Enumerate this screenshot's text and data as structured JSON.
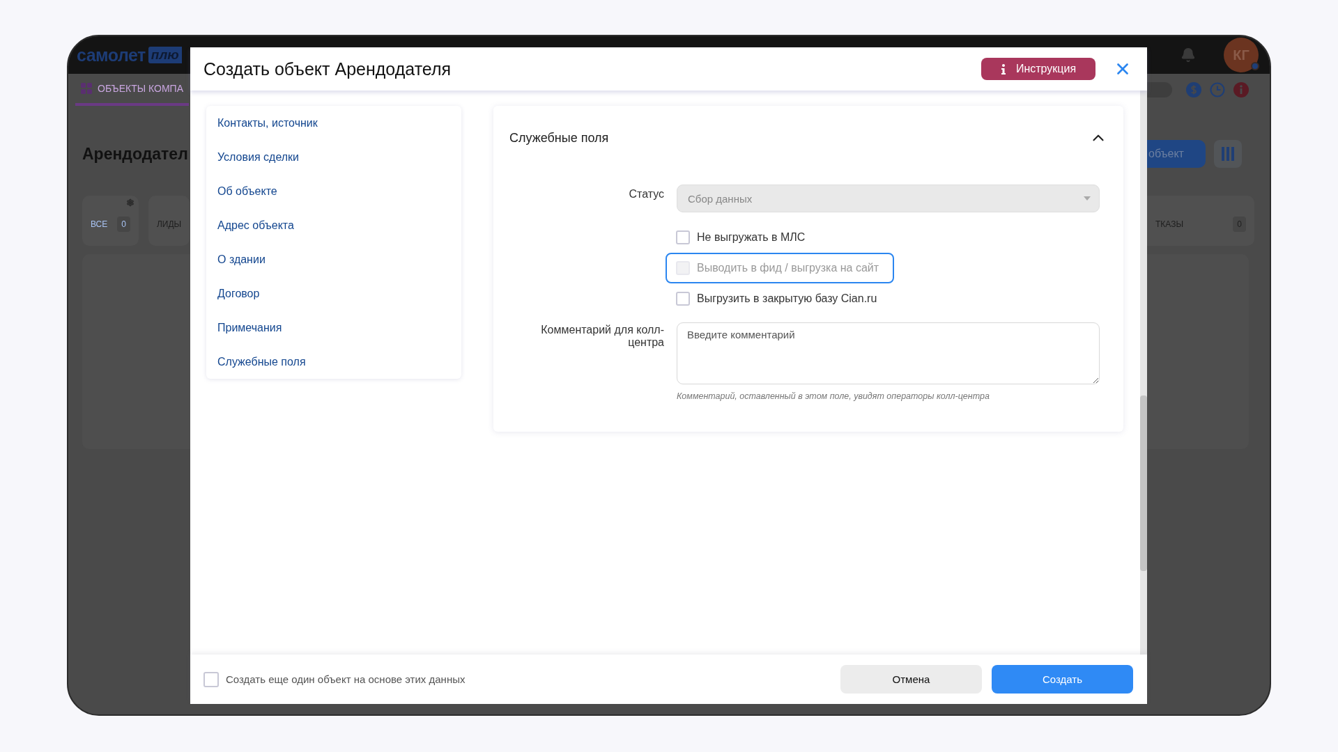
{
  "background": {
    "logo": {
      "text": "самолет",
      "badge": "плю"
    },
    "nav_tab": {
      "label": "ОБЪЕКТЫ КОМПА",
      "selected": true
    },
    "page_title": "Арендодател",
    "left_filters": [
      {
        "label": "ВСЕ",
        "count": "0",
        "selected": true
      },
      {
        "label": "ЛИДЫ",
        "selected": false
      }
    ],
    "right_filters": [
      {
        "label": "ТКАЗЫ",
        "count": "0",
        "selected": false
      }
    ],
    "add_button": "объект",
    "avatar": "КГ"
  },
  "modal": {
    "title": "Создать объект Арендодателя",
    "instruction_button": "Инструкция",
    "nav": [
      {
        "label": "Контакты, источник"
      },
      {
        "label": "Условия сделки"
      },
      {
        "label": "Об объекте"
      },
      {
        "label": "Адрес объекта"
      },
      {
        "label": "О здании"
      },
      {
        "label": "Договор"
      },
      {
        "label": "Примечания"
      },
      {
        "label": "Служебные поля"
      }
    ],
    "section": {
      "title": "Служебные поля",
      "expanded": true,
      "status": {
        "label": "Статус",
        "value": "Сбор данных",
        "disabled": true
      },
      "options": [
        {
          "label": "Не выгружать в МЛС",
          "checked": false,
          "disabled": false,
          "focused": false
        },
        {
          "label": "Выводить в фид / выгрузка на сайт",
          "checked": false,
          "disabled": true,
          "focused": true
        },
        {
          "label": "Выгрузить в закрытую базу Cian.ru",
          "checked": false,
          "disabled": false,
          "focused": false
        }
      ],
      "comment": {
        "label": "Комментарий для колл-центра",
        "placeholder": "Введите комментарий",
        "hint": "Комментарий, оставленный в этом поле, увидят операторы колл-центра"
      }
    },
    "footer": {
      "repeat": {
        "label": "Создать еще один объект на основе этих данных",
        "checked": false
      },
      "cancel": "Отмена",
      "submit": "Создать"
    }
  }
}
